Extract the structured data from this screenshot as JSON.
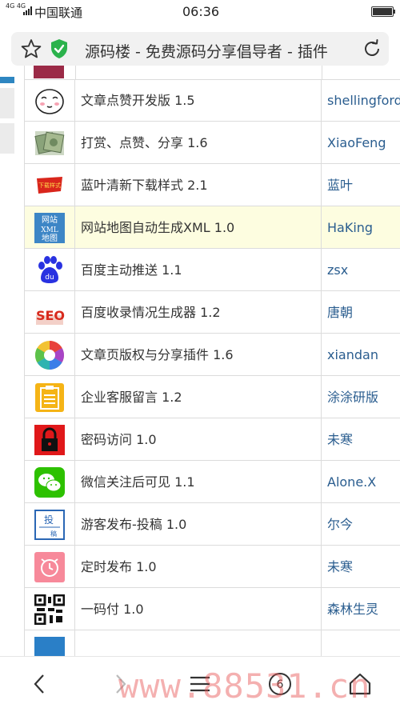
{
  "status_bar": {
    "network": "4G 4G",
    "carrier": "中国联通",
    "time": "06:36"
  },
  "address_bar": {
    "title": "源码楼 - 免费源码分享倡导者 - 插件"
  },
  "plugins": [
    {
      "icon": "face-sticker-icon",
      "name": "文章点赞开发版 1.5",
      "author": "shellingford"
    },
    {
      "icon": "money-icon",
      "name": "打赏、点赞、分享 1.6",
      "author": "XiaoFeng"
    },
    {
      "icon": "download-banner-icon",
      "name": "蓝叶清新下载样式 2.1",
      "author": "蓝叶",
      "icon_text": "下载样式"
    },
    {
      "icon": "sitemap-icon",
      "name": "网站地图自动生成XML 1.0",
      "author": "HaKing",
      "icon_text_1": "网站",
      "icon_text_2": "XML",
      "icon_text_3": "地图",
      "highlight": true
    },
    {
      "icon": "baidu-paw-icon",
      "name": "百度主动推送 1.1",
      "author": "zsx",
      "icon_text": "du"
    },
    {
      "icon": "seo-icon",
      "name": "百度收录情况生成器 1.2",
      "author": "唐朝",
      "icon_text": "SEO"
    },
    {
      "icon": "color-wheel-icon",
      "name": "文章页版权与分享插件 1.6",
      "author": "xiandan"
    },
    {
      "icon": "clipboard-icon",
      "name": "企业客服留言 1.2",
      "author": "涂涂研版"
    },
    {
      "icon": "lock-icon",
      "name": "密码访问 1.0",
      "author": "未寒"
    },
    {
      "icon": "wechat-icon",
      "name": "微信关注后可见 1.1",
      "author": "Alone.X"
    },
    {
      "icon": "submit-draft-icon",
      "name": "游客发布-投稿 1.0",
      "author": "尔今",
      "icon_text_1": "投",
      "icon_text_2": "稿"
    },
    {
      "icon": "alarm-clock-icon",
      "name": "定时发布 1.0",
      "author": "未寒"
    },
    {
      "icon": "qr-code-icon",
      "name": "一码付 1.0",
      "author": "森林生灵"
    }
  ],
  "bottom_nav": {
    "tab_count": "6"
  },
  "watermark": "www.88531.cn",
  "colors": {
    "author_link": "#2a5d8f",
    "highlight_row": "#fdfde0",
    "shield": "#2bb24c"
  }
}
